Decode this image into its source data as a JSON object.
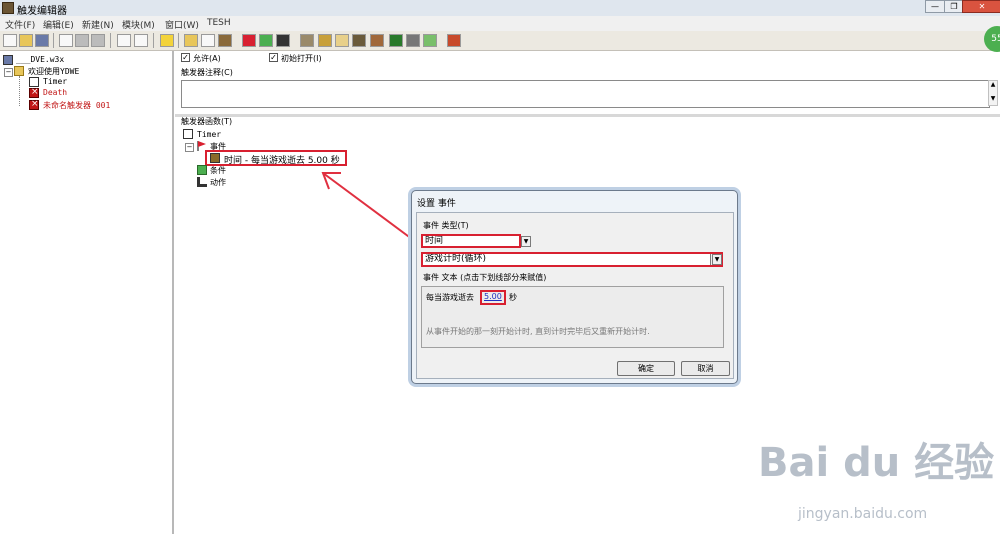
{
  "window": {
    "title": "触发编辑器",
    "minimize": "—",
    "maximize": "❐",
    "close": "✕"
  },
  "menu": [
    "文件(F)",
    "编辑(E)",
    "新建(N)",
    "模块(M)",
    "窗口(W)",
    "TESH"
  ],
  "left_tree": {
    "root": "___DVE.w3x",
    "folder": "欢迎使用YDWE",
    "items": [
      {
        "label": "Timer",
        "color": "#000000"
      },
      {
        "label": "Death",
        "color": "#c21818"
      },
      {
        "label": "未命名触发器 001",
        "color": "#c21818"
      }
    ]
  },
  "trigger": {
    "allow_label": "允许(A)",
    "initial_open_label": "初始打开(I)",
    "comment_label": "触发器注释(C)",
    "functions_label": "触发器函数(T)",
    "tree": {
      "name": "Timer",
      "event_label": "事件",
      "event_item": "时间 - 每当游戏逝去 5.00 秒",
      "condition_label": "条件",
      "action_label": "动作"
    }
  },
  "dialog": {
    "title": "设置 事件",
    "event_type_label": "事件 类型(T)",
    "event_type_value": "时间",
    "event_subtype_value": "游戏计时(循环)",
    "event_text_label": "事件 文本 (点击下划线部分来赋值)",
    "event_text_prefix": "每当游戏逝去",
    "event_text_value": "5.00",
    "event_text_suffix": "秒",
    "description": "从事件开始的那一刻开始计时, 直到计时完毕后又重新开始计时.",
    "ok": "确定",
    "cancel": "取消"
  },
  "watermark": {
    "text": "Bai du 经验",
    "url": "jingyan.baidu.com"
  },
  "badge": "55",
  "colors": {
    "highlight_red": "#d82030",
    "arrow_red": "#e03040"
  }
}
